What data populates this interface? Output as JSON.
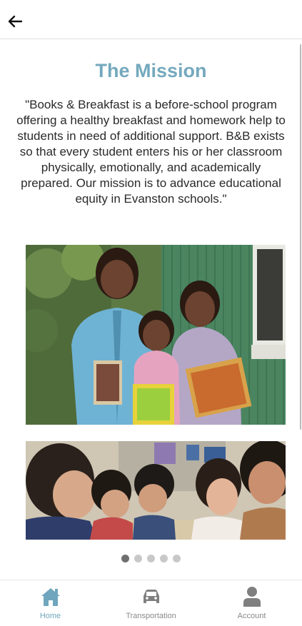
{
  "header": {
    "back_icon": "arrow-left-icon"
  },
  "mission": {
    "title": "The Mission",
    "text": "\"Books & Breakfast is a before-school program offering a healthy breakfast and homework help to students in need of additional support. B&B exists so that every student enters his or her classroom physically, emotionally, and academically prepared. Our mission is to advance educational equity in Evanston schools.\""
  },
  "carousel": {
    "dot_count": 5,
    "active_index": 0
  },
  "tabs": [
    {
      "label": "Home",
      "icon": "home-icon",
      "active": true
    },
    {
      "label": "Transportation",
      "icon": "car-icon",
      "active": false
    },
    {
      "label": "Account",
      "icon": "user-icon",
      "active": false
    }
  ],
  "colors": {
    "accent": "#74a9bd",
    "tab_active": "#6fa6bd",
    "tab_inactive": "#8a8a8a"
  }
}
